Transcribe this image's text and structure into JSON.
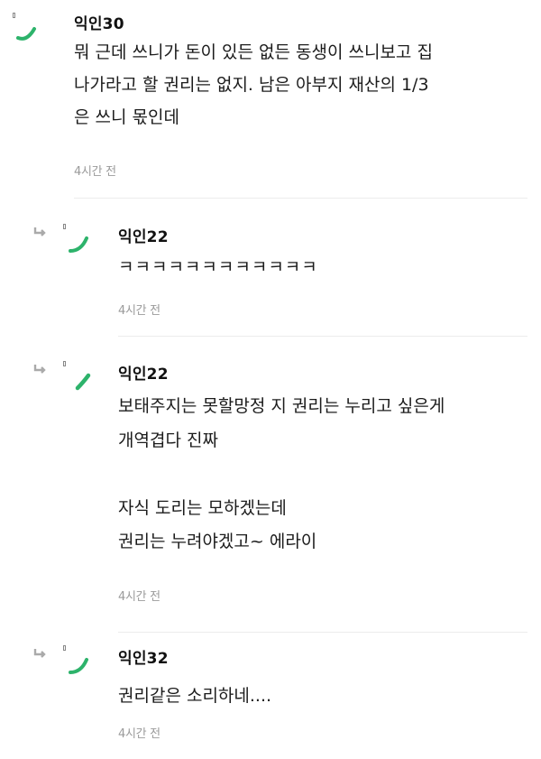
{
  "comments": [
    {
      "nickname": "익인30",
      "text": "뭐 근데 쓰니가 돈이 있든 없든 동생이 쓰니보고 집\n나가라고 할 권리는 없지. 남은 아부지 재산의 1/3\n은 쓰니 몫인데",
      "time": "4시간 전",
      "is_reply": false
    },
    {
      "nickname": "익인22",
      "text": "ㅋㅋㅋㅋㅋㅋㅋㅋㅋㅋㅋㅋ",
      "time": "4시간 전",
      "is_reply": true
    },
    {
      "nickname": "익인22",
      "text": "보태주지는 못할망정 지 권리는 누리고 싶은게\n개역겹다 진짜\n\n자식 도리는 모하겠는데\n권리는 누려야겠고~ 에라이",
      "time": "4시간 전",
      "is_reply": true
    },
    {
      "nickname": "익인32",
      "text": "권리같은 소리하네....",
      "time": "4시간 전",
      "is_reply": true
    }
  ],
  "colors": {
    "accent": "#2db36b",
    "time": "#9a9a9a",
    "divider": "#ececec"
  },
  "icons": {
    "reply": "reply-arrow-icon",
    "avatar": "avatar-icon"
  }
}
